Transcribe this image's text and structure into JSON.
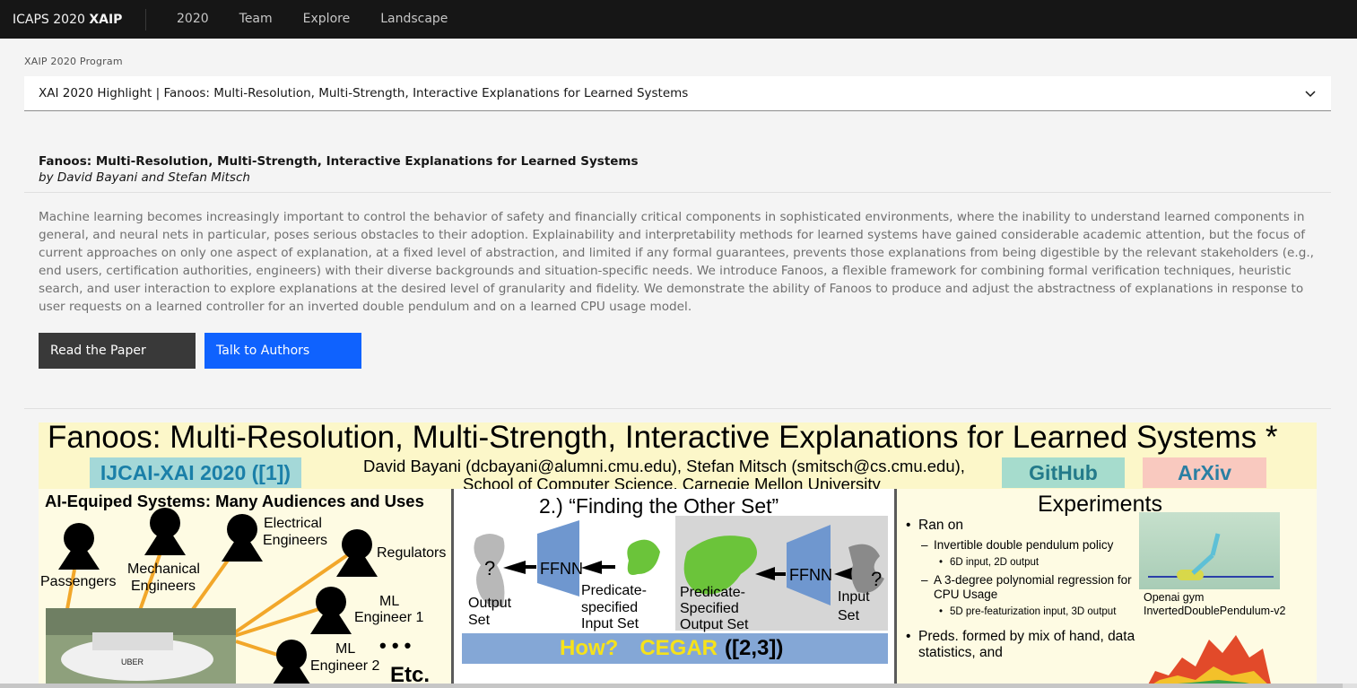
{
  "nav": {
    "brand_prefix": "ICAPS 2020",
    "brand_strong": "XAIP",
    "links": [
      "2020",
      "Team",
      "Explore",
      "Landscape"
    ]
  },
  "program": {
    "label": "XAIP 2020 Program",
    "selected": "XAI 2020 Highlight | Fanoos: Multi-Resolution, Multi-Strength, Interactive Explanations for Learned Systems"
  },
  "paper": {
    "title": "Fanoos: Multi-Resolution, Multi-Strength, Interactive Explanations for Learned Systems",
    "authors": "by David Bayani and Stefan Mitsch",
    "abstract": "Machine learning becomes increasingly important to control the behavior of safety and financially critical components in sophisticated environments, where the inability to understand learned components in general, and neural nets in particular, poses serious obstacles to their adoption. Explainability and interpretability methods for learned systems have gained considerable academic attention, but the focus of current approaches on only one aspect of explanation, at a fixed level of abstraction, and limited if any formal guarantees, prevents those explanations from being digestible by the relevant stakeholders (e.g., end users, certification authorities, engineers) with their diverse backgrounds and situation-specific needs. We introduce Fanoos, a flexible framework for combining formal verification techniques, heuristic search, and user interaction to explore explanations at the desired level of granularity and fidelity. We demonstrate the ability of Fanoos to produce and adjust the abstractness of explanations in response to user requests on a learned controller for an inverted double pendulum and on a learned CPU usage model.",
    "read_button": "Read the Paper",
    "talk_button": "Talk to Authors"
  },
  "poster": {
    "title": "Fanoos: Multi-Resolution, Multi-Strength, Interactive Explanations for Learned Systems *",
    "ijcai_tag": "IJCAI-XAI 2020 ([1])",
    "authors": "David Bayani (dcbayani@alumni.cmu.edu), Stefan Mitsch (smitsch@cs.cmu.edu),",
    "affiliation": "School of Computer Science, Carnegie Mellon University",
    "github_tag": "GitHub",
    "arxiv_tag": "ArXiv",
    "col1": {
      "title": "AI-Equiped Systems: Many Audiences and Uses",
      "passengers": "Passengers",
      "mechanical_1": "Mechanical",
      "mechanical_2": "Engineers",
      "electrical_1": "Electrical",
      "electrical_2": "Engineers",
      "regulators": "Regulators",
      "ml1_1": "ML",
      "ml1_2": "Engineer 1",
      "ml2_1": "ML",
      "ml2_2": "Engineer 2",
      "dots": "• • •",
      "etc": "Etc.",
      "uber": "UBER"
    },
    "col2": {
      "title": "2.) “Finding the Other Set”",
      "q": "?",
      "ffnn": "FFNN",
      "output_set_1": "Output",
      "output_set_2": "Set",
      "pred_input_1": "Predicate-",
      "pred_input_2": "specified",
      "pred_input_3": "Input Set",
      "pred_output_1": "Predicate-",
      "pred_output_2": "Specified",
      "pred_output_3": "Output Set",
      "input_set_1": "Input",
      "input_set_2": "Set",
      "how": "How?",
      "cegar": "CEGAR",
      "cegar_ref": "([2,3])"
    },
    "col3": {
      "title": "Experiments",
      "ran_on": "Ran on",
      "item1": "Invertible double pendulum policy",
      "item1_sub": "6D input, 2D output",
      "item2": "A 3-degree polynomial regression for CPU Usage",
      "item2_sub": "5D pre-featurization input, 3D output",
      "preds": "Preds. formed by mix of hand, data statistics, and",
      "gym_caption": "Openai gym InvertedDoublePendulum-v2"
    }
  },
  "colors": {
    "nav_bg": "#161616",
    "primary_button": "#0f62fe",
    "secondary_button": "#393939",
    "poster_header": "#fcf7c9",
    "cegar_bar": "#84a7d6",
    "cegar_text": "#f6e21a"
  }
}
